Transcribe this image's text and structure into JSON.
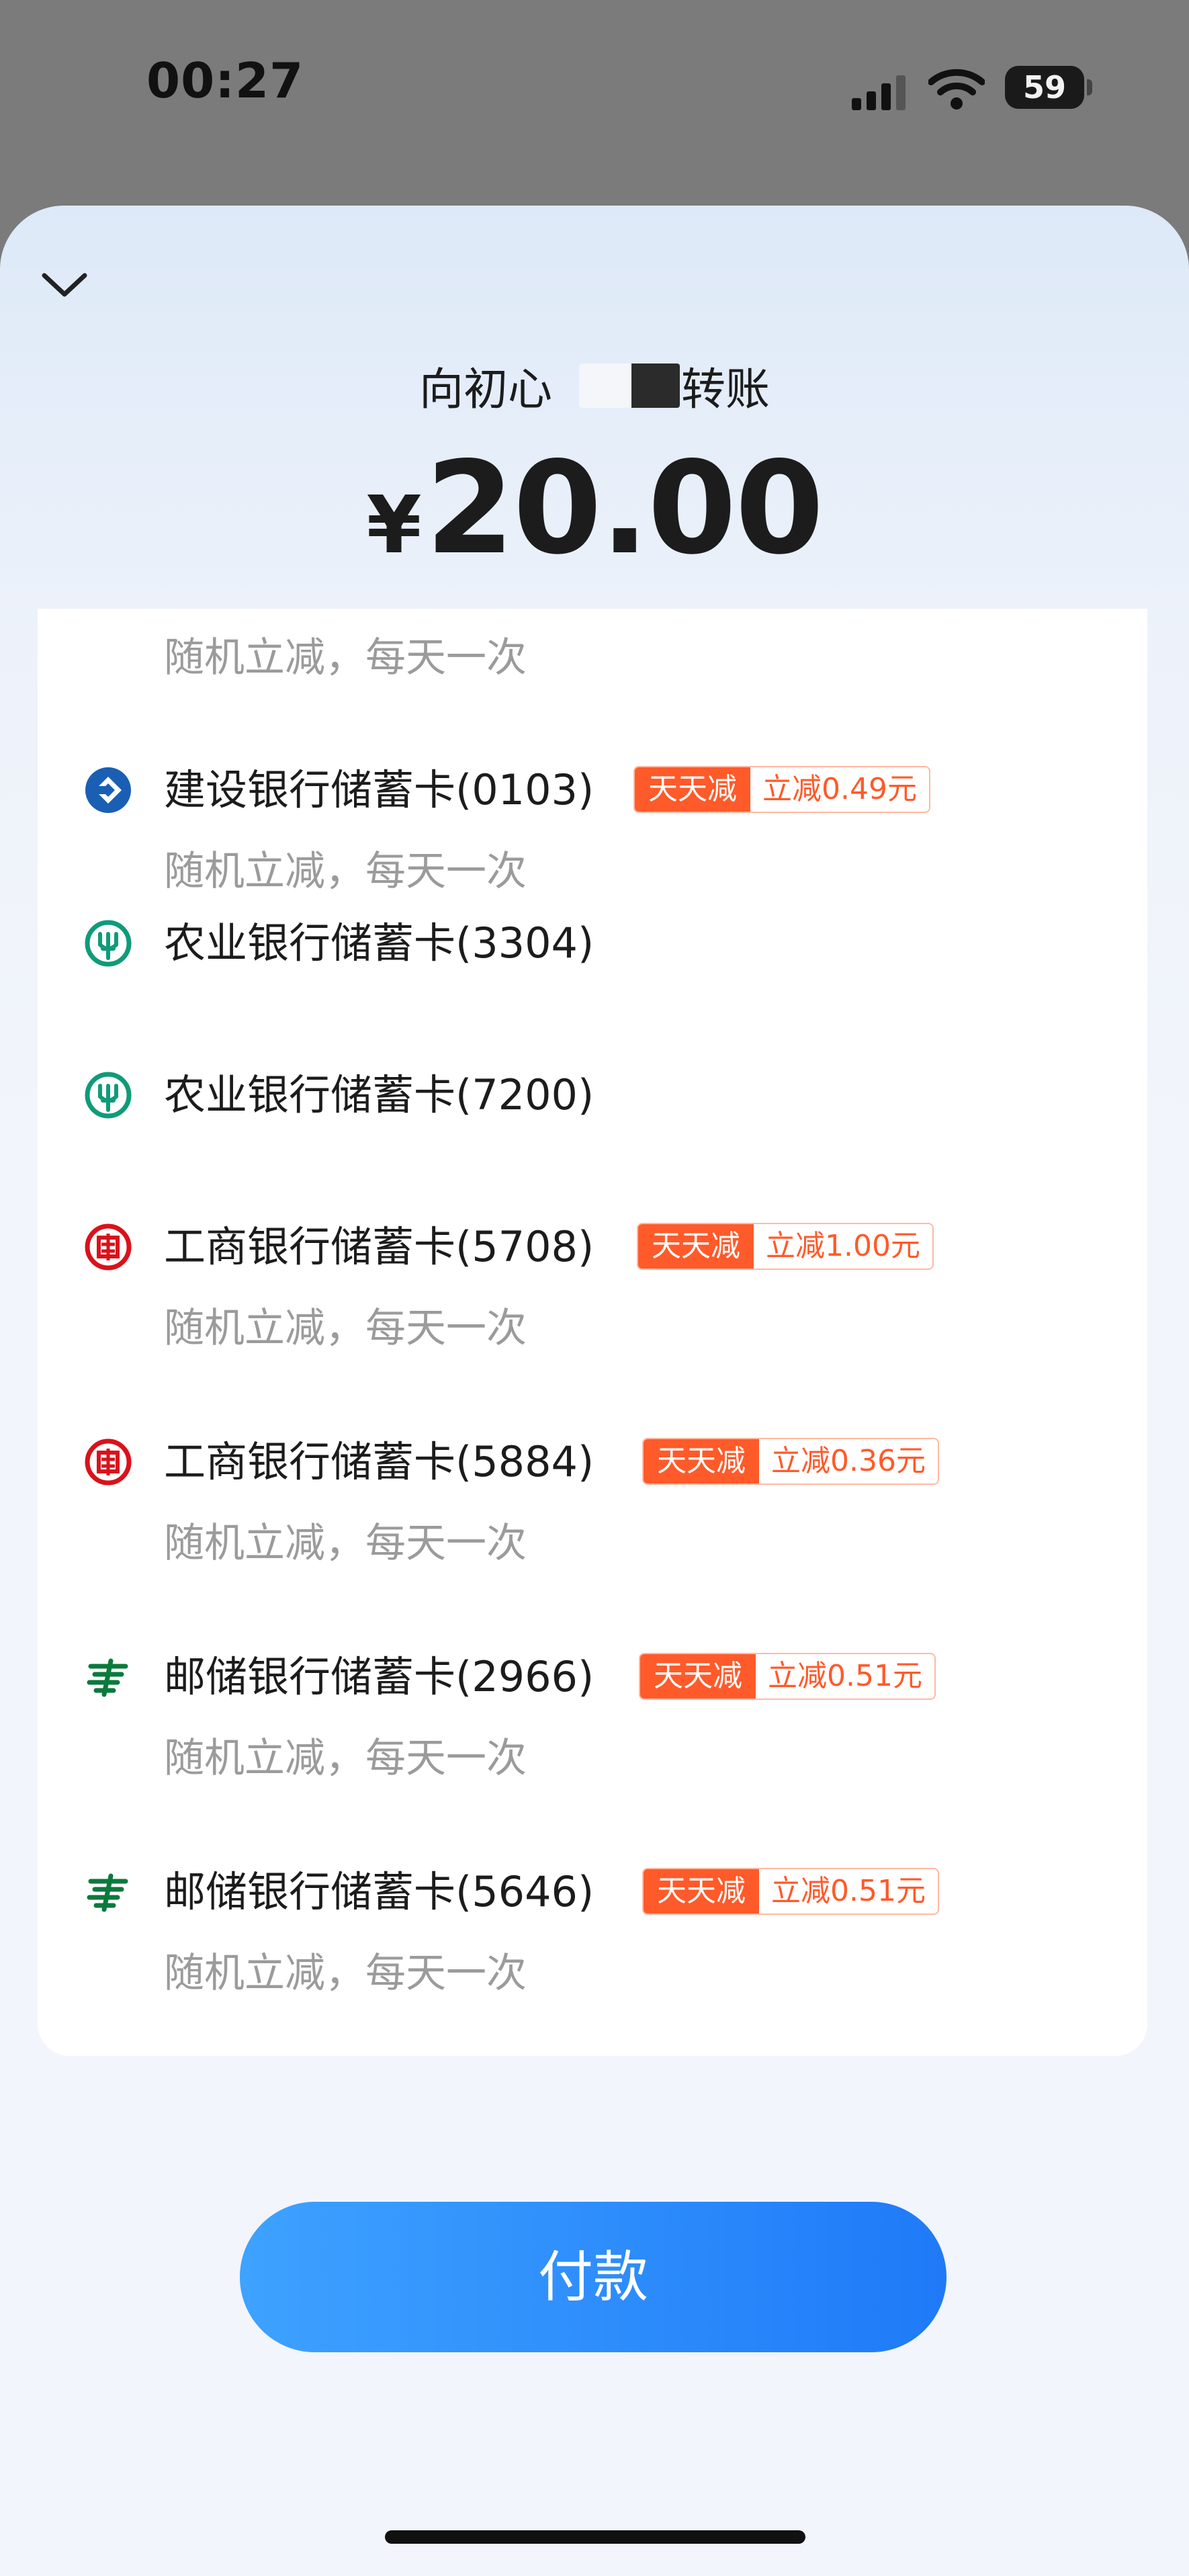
{
  "status_bar": {
    "time": "00:27",
    "battery": "59"
  },
  "header": {
    "payee_prefix": "向初心",
    "payee_suffix": "转账",
    "currency": "¥",
    "amount": "20.00"
  },
  "payment_methods": {
    "partial_top_note": "随机立减，每天一次",
    "items": [
      {
        "name": "建设银行储蓄卡(0103)",
        "icon": "ccb-icon",
        "promo_tag": "天天减",
        "promo_detail": "立减0.49元",
        "note": "随机立减，每天一次"
      },
      {
        "name": "农业银行储蓄卡(3304)",
        "icon": "abc-icon"
      },
      {
        "name": "农业银行储蓄卡(7200)",
        "icon": "abc-icon"
      },
      {
        "name": "工商银行储蓄卡(5708)",
        "icon": "icbc-icon",
        "promo_tag": "天天减",
        "promo_detail": "立减1.00元",
        "note": "随机立减，每天一次"
      },
      {
        "name": "工商银行储蓄卡(5884)",
        "icon": "icbc-icon",
        "promo_tag": "天天减",
        "promo_detail": "立减0.36元",
        "note": "随机立减，每天一次"
      },
      {
        "name": "邮储银行储蓄卡(2966)",
        "icon": "psbc-icon",
        "promo_tag": "天天减",
        "promo_detail": "立减0.51元",
        "note": "随机立减，每天一次"
      },
      {
        "name": "邮储银行储蓄卡(5646)",
        "icon": "psbc-icon",
        "promo_tag": "天天减",
        "promo_detail": "立减0.51元",
        "note": "随机立减，每天一次"
      }
    ]
  },
  "pay_button": {
    "label": "付款"
  },
  "colors": {
    "accent": "#1f7af8",
    "promo": "#ff5a2a",
    "ccb": "#1a5fb4",
    "abc": "#0f9b7a",
    "icbc": "#d9121b",
    "psbc": "#0a7a3c"
  }
}
